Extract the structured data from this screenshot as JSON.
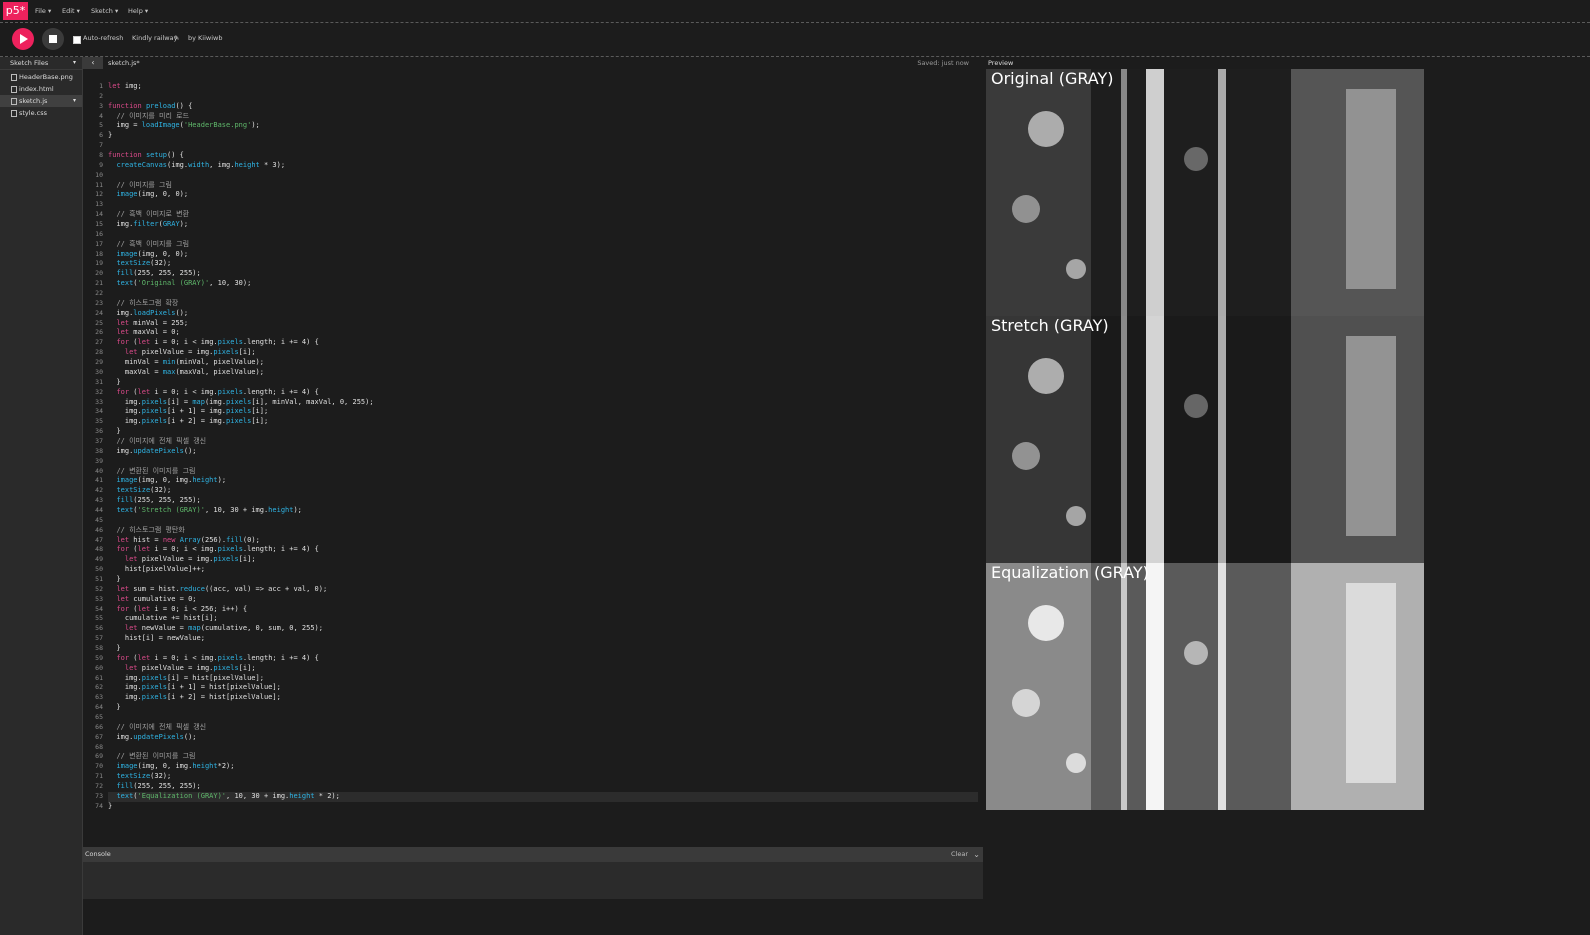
{
  "logo": "p5*",
  "menu": [
    "File ▾",
    "Edit ▾",
    "Sketch ▾",
    "Help ▾"
  ],
  "toolbar": {
    "auto_refresh": "Auto-refresh",
    "sketch_name": "Kindly railway",
    "by": "by Kiiwiwb"
  },
  "sidebar": {
    "header": "Sketch Files",
    "files": [
      "HeaderBase.png",
      "index.html",
      "sketch.js",
      "style.css"
    ]
  },
  "editor": {
    "tab": "sketch.js*",
    "saved": "Saved: just now",
    "line_count": 74
  },
  "preview": {
    "label": "Preview",
    "titles": [
      "Original (GRAY)",
      "Stretch (GRAY)",
      "Equalization (GRAY)"
    ]
  },
  "console": {
    "label": "Console",
    "clear": "Clear"
  },
  "colors": {
    "accent": "#ed225d",
    "keyword": "#db4a8a",
    "function": "#2fb4e4",
    "string": "#5fb86b",
    "background": "#1c1c1c"
  },
  "code": [
    "let img;",
    "",
    "function preload() {",
    "  // 이미지를 미리 로드",
    "  img = loadImage('HeaderBase.png');",
    "}",
    "",
    "function setup() {",
    "  createCanvas(img.width, img.height * 3);",
    "",
    "  // 이미지를 그림",
    "  image(img, 0, 0);",
    "",
    "  // 흑백 이미지로 변환",
    "  img.filter(GRAY);",
    "",
    "  // 흑백 이미지를 그림",
    "  image(img, 0, 0);",
    "  textSize(32);",
    "  fill(255, 255, 255);",
    "  text('Original (GRAY)', 10, 30);",
    "",
    "  // 히스토그램 확장",
    "  img.loadPixels();",
    "  let minVal = 255;",
    "  let maxVal = 0;",
    "  for (let i = 0; i < img.pixels.length; i += 4) {",
    "    let pixelValue = img.pixels[i];",
    "    minVal = min(minVal, pixelValue);",
    "    maxVal = max(maxVal, pixelValue);",
    "  }",
    "  for (let i = 0; i < img.pixels.length; i += 4) {",
    "    img.pixels[i] = map(img.pixels[i], minVal, maxVal, 0, 255);",
    "    img.pixels[i + 1] = img.pixels[i];",
    "    img.pixels[i + 2] = img.pixels[i];",
    "  }",
    "  // 이미지에 전체 픽셀 갱신",
    "  img.updatePixels();",
    "",
    "  // 변환된 이미지를 그림",
    "  image(img, 0, img.height);",
    "  textSize(32);",
    "  fill(255, 255, 255);",
    "  text('Stretch (GRAY)', 10, 30 + img.height);",
    "",
    "  // 히스토그램 평탄화",
    "  let hist = new Array(256).fill(0);",
    "  for (let i = 0; i < img.pixels.length; i += 4) {",
    "    let pixelValue = img.pixels[i];",
    "    hist[pixelValue]++;",
    "  }",
    "  let sum = hist.reduce((acc, val) => acc + val, 0);",
    "  let cumulative = 0;",
    "  for (let i = 0; i < 256; i++) {",
    "    cumulative += hist[i];",
    "    let newValue = map(cumulative, 0, sum, 0, 255);",
    "    hist[i] = newValue;",
    "  }",
    "  for (let i = 0; i < img.pixels.length; i += 4) {",
    "    let pixelValue = img.pixels[i];",
    "    img.pixels[i] = hist[pixelValue];",
    "    img.pixels[i + 1] = hist[pixelValue];",
    "    img.pixels[i + 2] = hist[pixelValue];",
    "  }",
    "",
    "  // 이미지에 전체 픽셀 갱신",
    "  img.updatePixels();",
    "",
    "  // 변환된 이미지를 그림",
    "  image(img, 0, img.height*2);",
    "  textSize(32);",
    "  fill(255, 255, 255);",
    "  text('Equalization (GRAY)', 10, 30 + img.height * 2);",
    "}"
  ]
}
